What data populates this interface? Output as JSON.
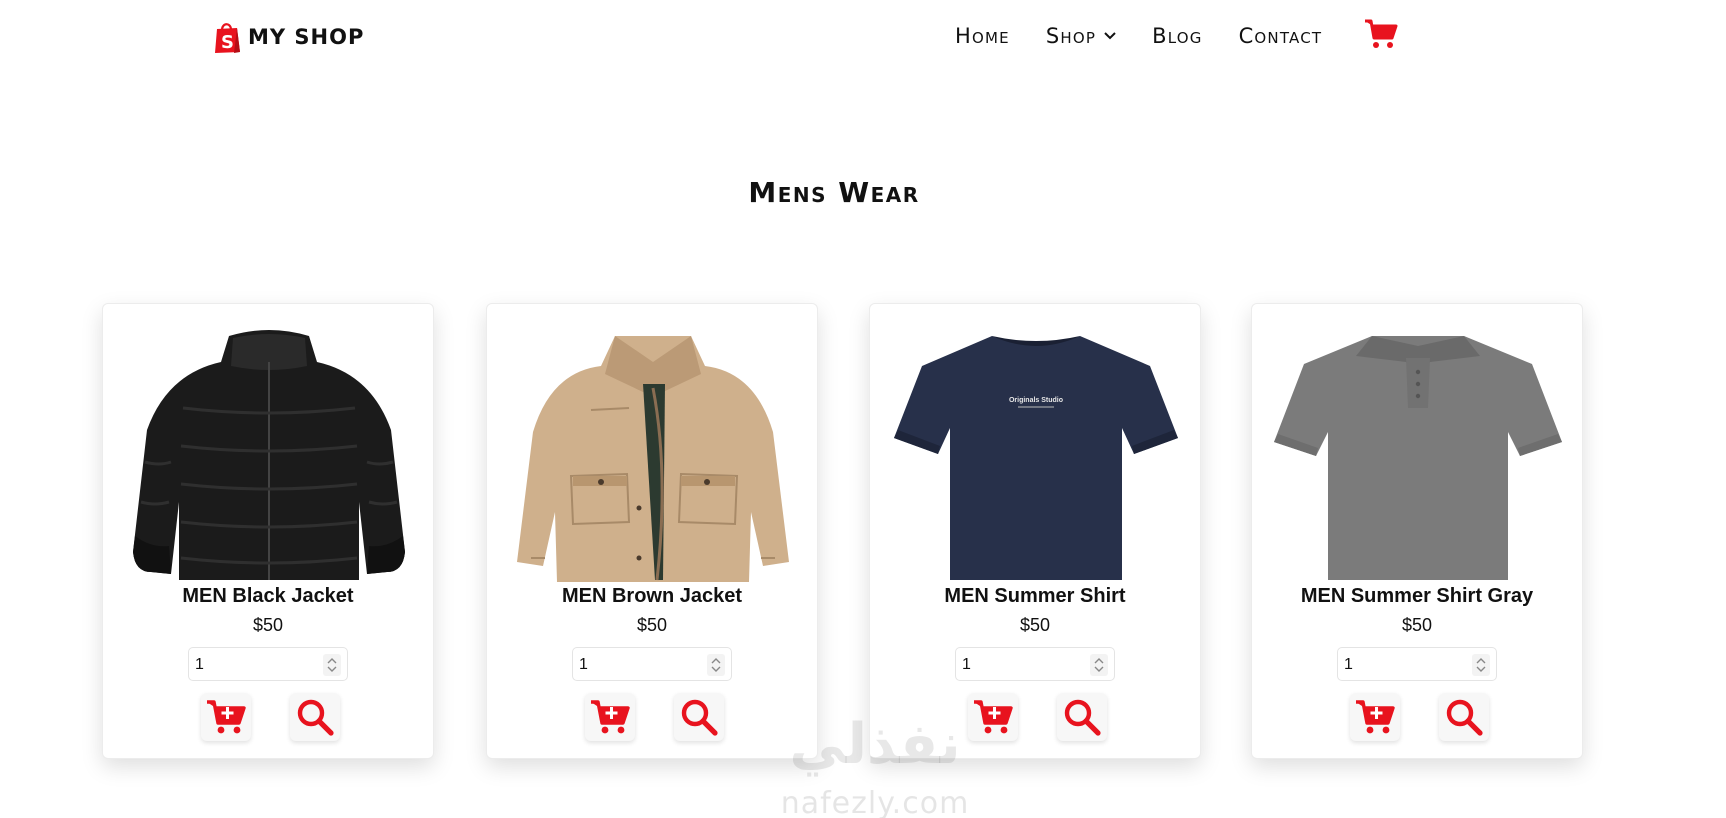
{
  "brand": {
    "name": "MY SHOP",
    "logo_icon": "shopping-bag-icon",
    "logo_letter": "S",
    "accent_color": "#e8131e"
  },
  "nav": {
    "items": [
      {
        "label": "Home"
      },
      {
        "label": "Shop",
        "has_dropdown": true
      },
      {
        "label": "Blog"
      },
      {
        "label": "Contact"
      }
    ],
    "cart_icon": "cart-icon"
  },
  "section": {
    "title": "Mens Wear"
  },
  "products": [
    {
      "name": "MEN Black Jacket",
      "price": "$50",
      "quantity": "1",
      "image": "black-puffer-jacket"
    },
    {
      "name": "MEN Brown Jacket",
      "price": "$50",
      "quantity": "1",
      "image": "brown-field-jacket"
    },
    {
      "name": "MEN Summer Shirt",
      "price": "$50",
      "quantity": "1",
      "image": "navy-t-shirt",
      "shirt_print": "Originals Studio"
    },
    {
      "name": "MEN Summer Shirt Gray",
      "price": "$50",
      "quantity": "1",
      "image": "gray-polo-shirt"
    }
  ],
  "actions": {
    "add_icon": "add-to-cart-icon",
    "view_icon": "search-icon"
  },
  "watermark": {
    "arabic": "نفذلي",
    "latin": "nafezly.com"
  }
}
